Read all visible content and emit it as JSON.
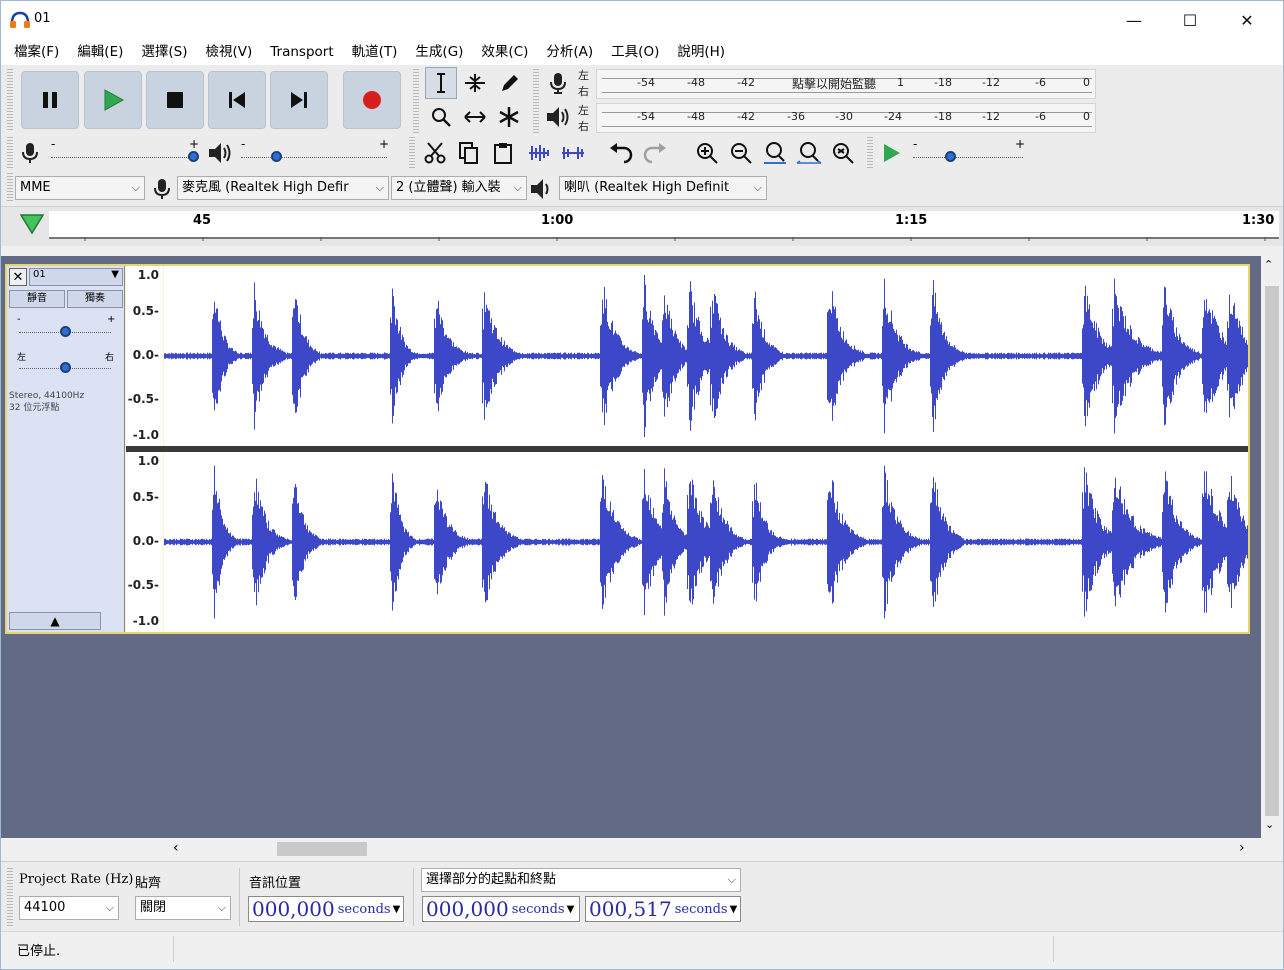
{
  "window": {
    "title": "01",
    "minimize_glyph": "—",
    "maximize_glyph": "☐",
    "close_glyph": "✕"
  },
  "menu": [
    "檔案(F)",
    "編輯(E)",
    "選擇(S)",
    "檢視(V)",
    "Transport",
    "軌道(T)",
    "生成(G)",
    "效果(C)",
    "分析(A)",
    "工具(O)",
    "說明(H)"
  ],
  "meters": {
    "record_lr": [
      "左",
      "右"
    ],
    "play_lr": [
      "左",
      "右"
    ],
    "record_scale": [
      "-54",
      "-48",
      "-42",
      "點擊以開始監聽",
      "1",
      "-18",
      "-12",
      "-6",
      "0"
    ],
    "play_scale": [
      "-54",
      "-48",
      "-42",
      "-36",
      "-30",
      "-24",
      "-18",
      "-12",
      "-6",
      "0"
    ]
  },
  "mixer": {
    "rec_minus": "-",
    "rec_plus": "+",
    "play_minus": "-",
    "play_plus": "+",
    "record_level": 1.0,
    "playback_level": 0.25,
    "play_speed_minus": "-",
    "play_speed_plus": "+"
  },
  "devices": {
    "host": "MME",
    "recording_device": "麥克風 (Realtek High Defir",
    "channels": "2 (立體聲) 輸入裝",
    "playback_device": "喇叭 (Realtek High Definit"
  },
  "timeline": {
    "ticks": [
      "45",
      "1:00",
      "1:15",
      "1:30"
    ]
  },
  "track": {
    "name": "01",
    "mute": "靜音",
    "solo": "獨奏",
    "gain_minus": "-",
    "gain_plus": "+",
    "pan_left": "左",
    "pan_right": "右",
    "info_line1": "Stereo, 44100Hz",
    "info_line2": "32 位元浮點",
    "scale": [
      "1.0",
      "0.5-",
      "0.0-",
      "-0.5-",
      "-1.0"
    ],
    "gain": 0.5,
    "pan": 0.5
  },
  "selection": {
    "project_rate_label": "Project Rate (Hz)",
    "project_rate": "44100",
    "snap_label": "貼齊",
    "snap_value": "關閉",
    "audio_pos_label": "音訊位置",
    "audio_pos_num": "000,000",
    "audio_pos_unit": "seconds",
    "sel_mode": "選擇部分的起點和終點",
    "sel_start_num": "000,000",
    "sel_start_unit": "seconds",
    "sel_end_num": "000,517",
    "sel_end_unit": "seconds"
  },
  "status": "已停止.",
  "colors": {
    "wave": "#3c48c8",
    "track_bg": "#636a85",
    "record": "#d62020",
    "play": "#2fa84f"
  }
}
